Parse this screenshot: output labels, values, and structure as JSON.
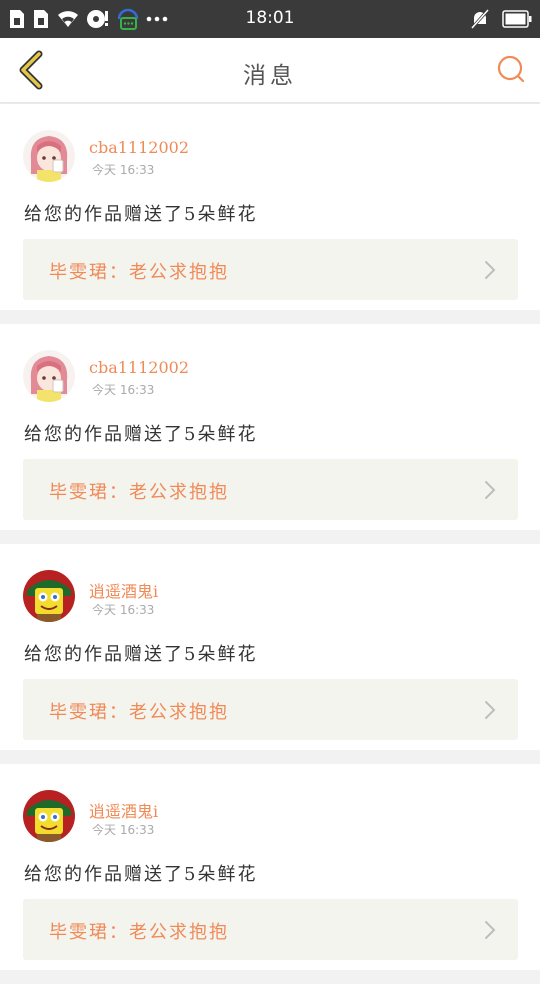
{
  "status_bar": {
    "time": "18:01",
    "left_icons": [
      "sim-card-icon",
      "sim-card-icon",
      "wifi-icon",
      "media-icon",
      "chat-notification-icon",
      "more-dots-icon"
    ],
    "right_icons": [
      "mute-icon",
      "battery-icon"
    ]
  },
  "nav": {
    "title": "消息",
    "back_icon": "chevron-left-icon",
    "search_icon": "search-icon",
    "accent_color": "#f08a57"
  },
  "messages": [
    {
      "username": "cba1112002",
      "time": "今天 16:33",
      "message": "给您的作品赠送了5朵鲜花",
      "work_title": "毕雯珺：老公求抱抱",
      "avatar": "anime-girl-avatar"
    },
    {
      "username": "cba1112002",
      "time": "今天 16:33",
      "message": "给您的作品赠送了5朵鲜花",
      "work_title": "毕雯珺：老公求抱抱",
      "avatar": "anime-girl-avatar"
    },
    {
      "username": "逍遥酒鬼i",
      "time": "今天 16:33",
      "message": "给您的作品赠送了5朵鲜花",
      "work_title": "毕雯珺：老公求抱抱",
      "avatar": "spongebob-avatar"
    },
    {
      "username": "逍遥酒鬼i",
      "time": "今天 16:33",
      "message": "给您的作品赠送了5朵鲜花",
      "work_title": "毕雯珺：老公求抱抱",
      "avatar": "spongebob-avatar"
    }
  ]
}
